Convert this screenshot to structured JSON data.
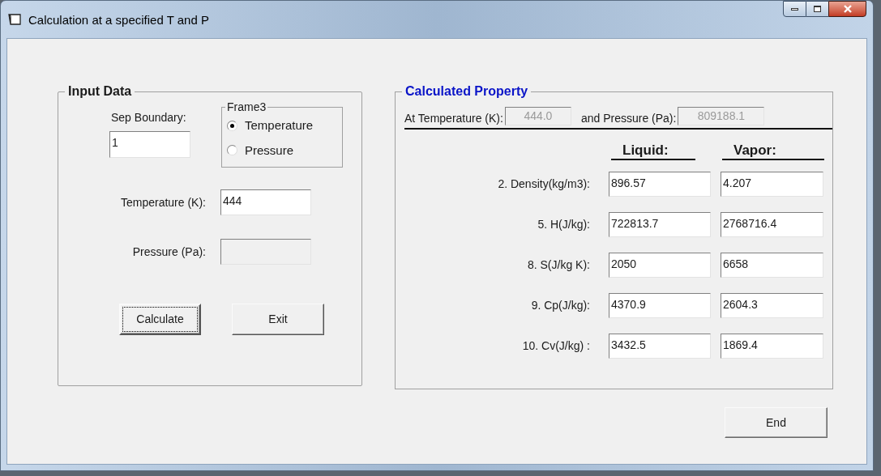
{
  "window": {
    "title": "Calculation at a specified T and P"
  },
  "input_data": {
    "title": "Input Data",
    "sep_boundary": {
      "label": "Sep Boundary:",
      "value": "1"
    },
    "frame": {
      "title": "Frame3",
      "options": [
        {
          "label": "Temperature",
          "selected": true
        },
        {
          "label": "Pressure",
          "selected": false
        }
      ]
    },
    "fields": [
      {
        "label": "Temperature (K):",
        "value": "444",
        "disabled": false
      },
      {
        "label": "Pressure (Pa):",
        "disabled": true
      }
    ],
    "buttons": [
      {
        "label": "Calculate",
        "focused": true
      },
      {
        "label": "Exit",
        "focused": false
      }
    ]
  },
  "calculated_property": {
    "title": "Calculated Property",
    "conditions": [
      {
        "label": "At Temperature (K):",
        "value": "444.0",
        "disabled": true
      },
      {
        "label": "and Pressure (Pa):",
        "value": "809188.1",
        "disabled": true
      }
    ],
    "columns": [
      "Liquid:",
      "Vapor:"
    ],
    "rows": [
      {
        "label": "2. Density(kg/m3):",
        "values": [
          "896.57",
          "4.207"
        ]
      },
      {
        "label": "5. H(J/kg):",
        "values": [
          "722813.7",
          "2768716.4"
        ]
      },
      {
        "label": "8. S(J/kg K):",
        "values": [
          "2050",
          "6658"
        ]
      },
      {
        "label": "9. Cp(J/kg):",
        "values": [
          "4370.9",
          "2604.3"
        ]
      },
      {
        "label": "10. Cv(J/kg) :",
        "values": [
          "3432.5",
          "1869.4"
        ]
      }
    ]
  },
  "end_button": {
    "label": "End"
  }
}
